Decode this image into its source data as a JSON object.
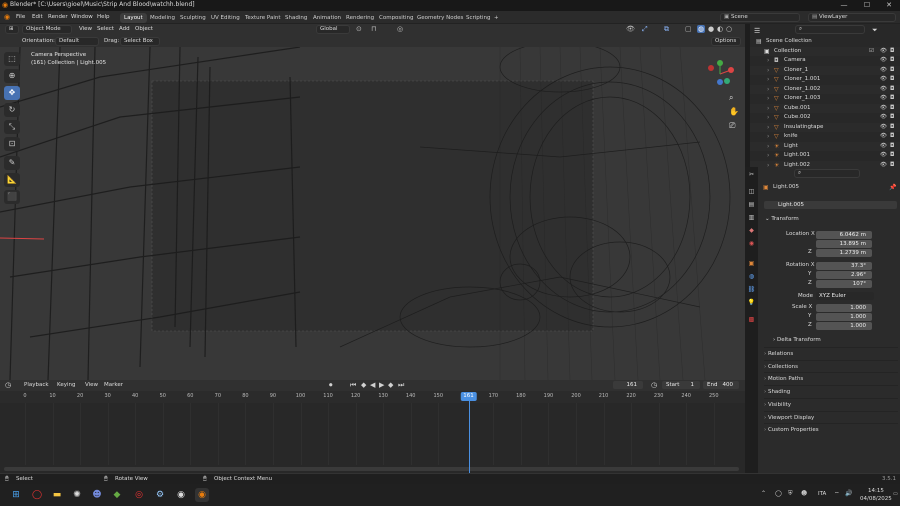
{
  "window": {
    "title": "Blender* [C:\\Users\\gioel\\Music\\Strip And Blood\\watchh.blend]",
    "minimize": "—",
    "maximize": "☐",
    "close": "✕"
  },
  "menubar": {
    "menus": [
      "File",
      "Edit",
      "Render",
      "Window",
      "Help"
    ],
    "workspaces": [
      "Layout",
      "Modeling",
      "Sculpting",
      "UV Editing",
      "Texture Paint",
      "Shading",
      "Animation",
      "Rendering",
      "Compositing",
      "Geometry Nodes",
      "Scripting",
      "+"
    ],
    "active_workspace": "Layout",
    "scene": "Scene",
    "view_layer": "ViewLayer"
  },
  "viewport_header": {
    "mode": "Object Mode",
    "menus": [
      "View",
      "Select",
      "Add",
      "Object"
    ],
    "transform_orientation": "Global",
    "orientation_label": "Orientation:",
    "orientation_value": "Default",
    "drag_label": "Drag:",
    "drag_value": "Select Box",
    "options": "Options"
  },
  "viewport": {
    "camera_label": "Camera Perspective",
    "camera_sub": "(161) Collection | Light.005"
  },
  "outliner": {
    "header": "Scene Collection",
    "collection": "Collection",
    "items": [
      {
        "name": "Camera",
        "icon": "camera-icon",
        "color": "#b8b8b8"
      },
      {
        "name": "Cloner_1",
        "icon": "mesh-icon",
        "color": "#e0883a"
      },
      {
        "name": "Cloner_1.001",
        "icon": "mesh-icon",
        "color": "#e0883a"
      },
      {
        "name": "Cloner_1.002",
        "icon": "mesh-icon",
        "color": "#e0883a"
      },
      {
        "name": "Cloner_1.003",
        "icon": "mesh-icon",
        "color": "#e0883a"
      },
      {
        "name": "Cube.001",
        "icon": "mesh-icon",
        "color": "#e0883a"
      },
      {
        "name": "Cube.002",
        "icon": "mesh-icon",
        "color": "#e0883a"
      },
      {
        "name": "Insulatingtape",
        "icon": "mesh-icon",
        "color": "#e0883a"
      },
      {
        "name": "knife",
        "icon": "mesh-icon",
        "color": "#e0883a"
      },
      {
        "name": "Light",
        "icon": "light-icon",
        "color": "#e0883a"
      },
      {
        "name": "Light.001",
        "icon": "light-icon",
        "color": "#e0883a"
      },
      {
        "name": "Light.002",
        "icon": "light-icon",
        "color": "#e0883a"
      }
    ]
  },
  "properties": {
    "object_name": "Light.005",
    "data_name": "Light.005",
    "transform_label": "Transform",
    "location_label": "Location X",
    "location": [
      "6.0462 m",
      "13.895 m",
      "1.2739 m"
    ],
    "rotation_label": "Rotation X",
    "rotation": [
      "37.3°",
      "2.96°",
      "107°"
    ],
    "axis_y": "Y",
    "axis_z": "Z",
    "mode_label": "Mode",
    "mode_value": "XYZ Euler",
    "scale_label": "Scale X",
    "scale": [
      "1.000",
      "1.000",
      "1.000"
    ],
    "delta_transform": "Delta Transform",
    "panels": [
      "Relations",
      "Collections",
      "Motion Paths",
      "Shading",
      "Visibility",
      "Viewport Display",
      "Custom Properties"
    ]
  },
  "timeline": {
    "menus": [
      "Playback",
      "Keying",
      "View",
      "Marker"
    ],
    "current_frame": "161",
    "start_label": "Start",
    "start": "1",
    "end_label": "End",
    "end": "400",
    "ticks": [
      "0",
      "10",
      "20",
      "30",
      "40",
      "50",
      "60",
      "70",
      "80",
      "90",
      "100",
      "110",
      "120",
      "130",
      "140",
      "150",
      "161",
      "170",
      "180",
      "190",
      "200",
      "210",
      "220",
      "230",
      "240",
      "250"
    ],
    "playhead_frame": 161
  },
  "statusbar": {
    "select": "Select",
    "rotate": "Rotate View",
    "context": "Object Context Menu",
    "version": "3.5.1"
  },
  "taskbar": {
    "lang": "ITA",
    "time": "14:15",
    "date": "04/08/2025"
  },
  "colors": {
    "accent": "#4772b3",
    "playhead": "#4a90e2",
    "selected": "#e0883a"
  }
}
